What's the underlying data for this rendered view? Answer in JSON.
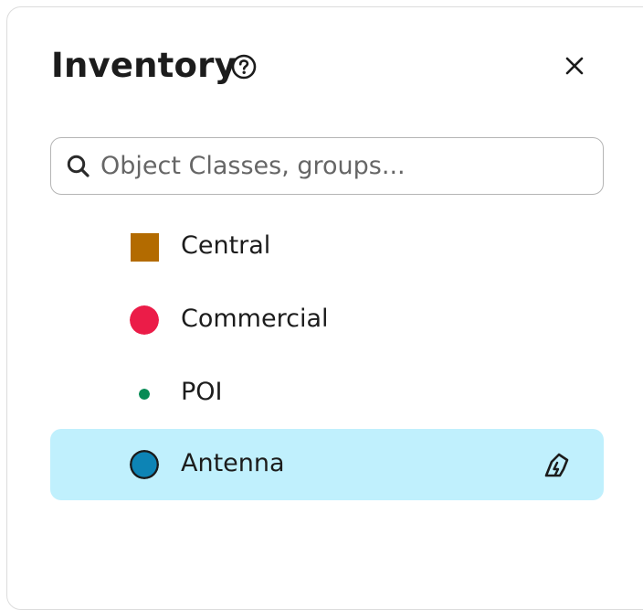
{
  "panel": {
    "title": "Inventory"
  },
  "search": {
    "placeholder": "Object Classes, groups..."
  },
  "colors": {
    "central": "#b36b00",
    "commercial": "#eb1c48",
    "poi": "#078b55",
    "antenna_fill": "#0d84b5",
    "antenna_stroke": "#1a1a1a",
    "selected_bg": "#c0f0fd"
  },
  "items": [
    {
      "label": "Central",
      "symbol": "square",
      "color": "#b36b00",
      "selected": false
    },
    {
      "label": "Commercial",
      "symbol": "circle",
      "color": "#eb1c48",
      "selected": false
    },
    {
      "label": "POI",
      "symbol": "dot",
      "color": "#078b55",
      "selected": false
    },
    {
      "label": "Antenna",
      "symbol": "circle-outlined",
      "color": "#0d84b5",
      "selected": true,
      "action_icon": "edit-style-icon"
    }
  ]
}
